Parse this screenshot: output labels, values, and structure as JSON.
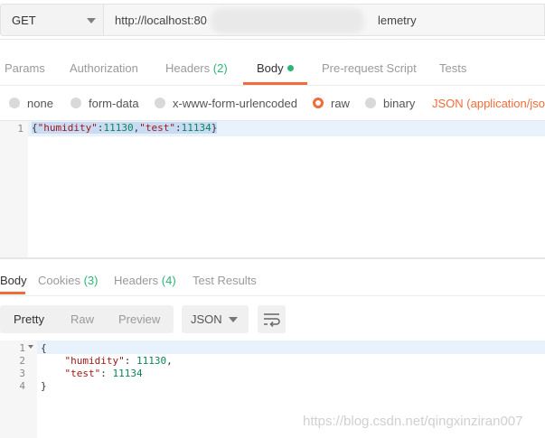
{
  "request": {
    "method": "GET",
    "url_prefix": "http://localhost:80",
    "url_suffix": "lemetry"
  },
  "request_tabs": [
    {
      "label": "Params"
    },
    {
      "label": "Authorization"
    },
    {
      "label": "Headers",
      "count": "(2)"
    },
    {
      "label": "Body"
    },
    {
      "label": "Pre-request Script"
    },
    {
      "label": "Tests"
    }
  ],
  "body_types": {
    "none": "none",
    "form_data": "form-data",
    "urlencoded": "x-www-form-urlencoded",
    "raw": "raw",
    "binary": "binary",
    "content_type": "JSON (application/json"
  },
  "request_editor": {
    "line_number": "1",
    "text": "{\"humidity\":11130,\"test\":11134}",
    "brace_open": "{",
    "key1": "\"humidity\"",
    "colon": ":",
    "val1": "11130",
    "comma": ",",
    "key2": "\"test\"",
    "val2": "11134",
    "brace_close": "}"
  },
  "response_tabs": [
    {
      "label": "Body"
    },
    {
      "label": "Cookies",
      "count": "(3)"
    },
    {
      "label": "Headers",
      "count": "(4)"
    },
    {
      "label": "Test Results"
    }
  ],
  "response_toolbar": {
    "pretty": "Pretty",
    "raw": "Raw",
    "preview": "Preview",
    "format": "JSON",
    "wrap_icon": "wrap-lines-icon"
  },
  "response_body": {
    "lines": [
      "{",
      "    \"humidity\": 11130,",
      "    \"test\": 11134",
      "}"
    ],
    "line_numbers": [
      "1",
      "2",
      "3",
      "4"
    ],
    "k1": "\"humidity\"",
    "v1": "11130",
    "k2": "\"test\"",
    "v2": "11134"
  },
  "watermark": "https://blog.csdn.net/qingxinziran007",
  "colors": {
    "accent": "#f26b3a",
    "count_green": "#2bb673"
  }
}
